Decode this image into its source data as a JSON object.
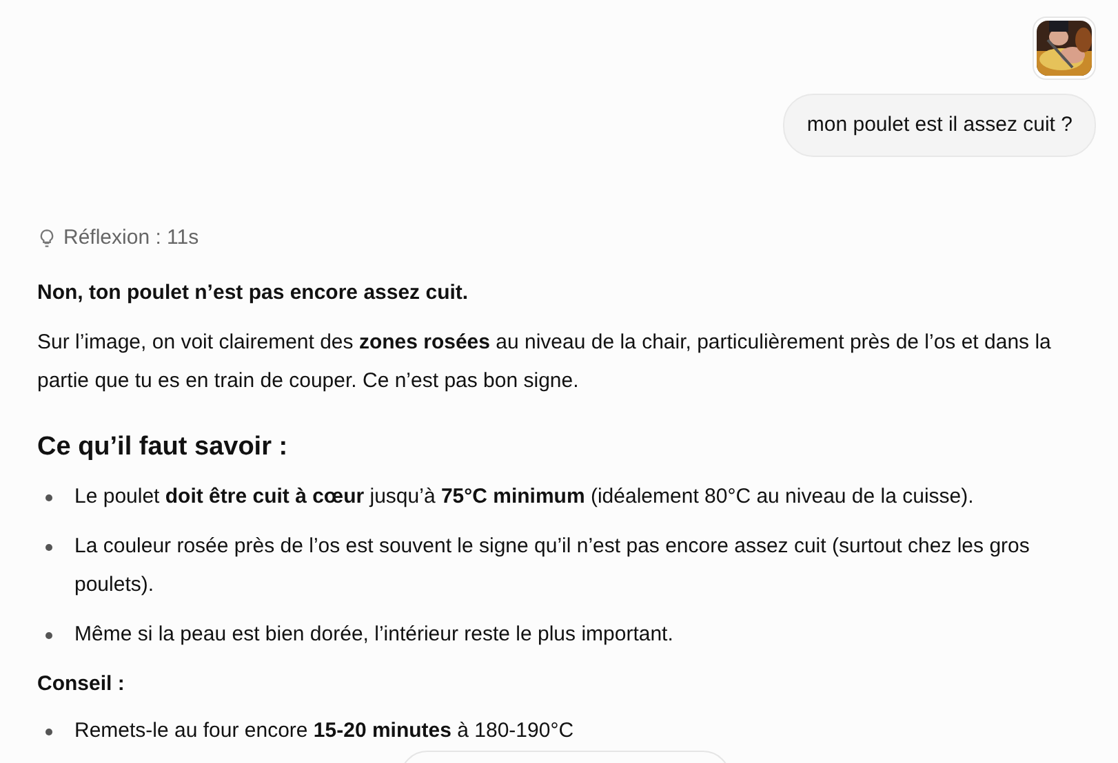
{
  "user_message": {
    "text": "mon poulet est il assez cuit ?"
  },
  "reply": {
    "reasoning": "Réflexion : 11s",
    "blocks": [
      {
        "kind": "lead",
        "text": "Non, ton poulet n’est pas encore assez cuit."
      },
      {
        "kind": "paragraph",
        "text": "Sur l’image, on voit clairement des **zones rosées** au niveau de la chair, particulièrement près de l’os et dans la partie que tu es en train de couper. Ce n’est pas bon signe."
      },
      {
        "kind": "heading",
        "text": "Ce qu’il faut savoir :"
      },
      {
        "kind": "list",
        "items": [
          "Le poulet **doit être cuit à cœur** jusqu’à **75°C minimum** (idéalement 80°C au niveau de la cuisse).",
          "La couleur rosée près de l’os est souvent le signe qu’il n’est pas encore assez cuit (surtout chez les gros poulets).",
          "Même si la peau est bien dorée, l’intérieur reste le plus important."
        ]
      },
      {
        "kind": "subheading",
        "text": "Conseil :"
      },
      {
        "kind": "list",
        "items": [
          "Remets-le au four encore **15-20 minutes** à 180-190°C"
        ]
      }
    ]
  }
}
